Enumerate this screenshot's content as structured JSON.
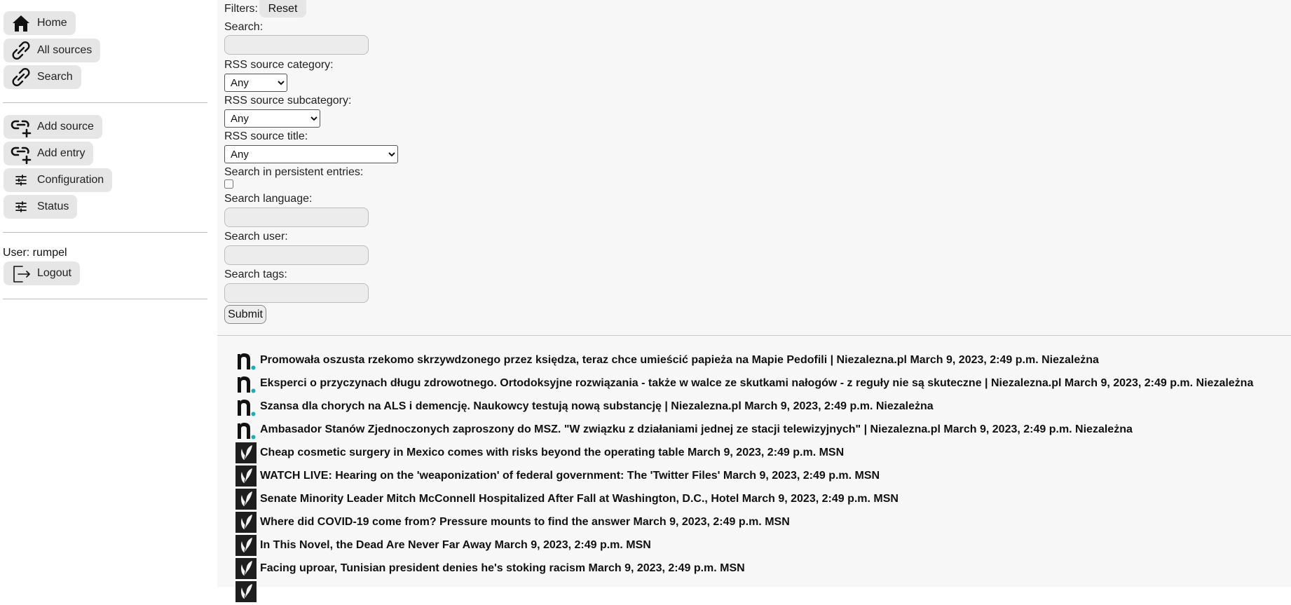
{
  "sidebar": {
    "nav": [
      {
        "label": "Home",
        "icon": "home-icon"
      },
      {
        "label": "All sources",
        "icon": "link-icon"
      },
      {
        "label": "Search",
        "icon": "link-icon"
      }
    ],
    "actions": [
      {
        "label": "Add source",
        "icon": "add-link-icon"
      },
      {
        "label": "Add entry",
        "icon": "add-link-icon"
      },
      {
        "label": "Configuration",
        "icon": "tune-icon"
      },
      {
        "label": "Status",
        "icon": "tune-icon"
      }
    ],
    "user_label": "User: rumpel",
    "logout_label": "Logout"
  },
  "filters": {
    "title": "Filters:",
    "reset_label": "Reset",
    "search_label": "Search:",
    "search_value": "",
    "category_label": "RSS source category:",
    "category_value": "Any",
    "subcategory_label": "RSS source subcategory:",
    "subcategory_value": "Any",
    "source_title_label": "RSS source title:",
    "source_title_value": "Any",
    "persistent_label": "Search in persistent entries:",
    "persistent_checked": false,
    "language_label": "Search language:",
    "language_value": "",
    "user_label": "Search user:",
    "user_value": "",
    "tags_label": "Search tags:",
    "tags_value": "",
    "submit_label": "Submit"
  },
  "entries": [
    {
      "text": "Promowała oszusta rzekomo skrzywdzonego przez księdza, teraz chce umieścić papieża na Mapie Pedofili | Niezalezna.pl March 9, 2023, 2:49 p.m. Niezależna",
      "source": "niezalezna-logo-icon"
    },
    {
      "text": "Eksperci o przyczynach długu zdrowotnego. Ortodoksyjne rozwiązania - także w walce ze skutkami nałogów - z reguły nie są skuteczne | Niezalezna.pl March 9, 2023, 2:49 p.m. Niezależna",
      "source": "niezalezna-logo-icon"
    },
    {
      "text": "Szansa dla chorych na ALS i demencję. Naukowcy testują nową substancję | Niezalezna.pl March 9, 2023, 2:49 p.m. Niezależna",
      "source": "niezalezna-logo-icon"
    },
    {
      "text": "Ambasador Stanów Zjednoczonych zaproszony do MSZ. \"W związku z działaniami jednej ze stacji telewizyjnych\" | Niezalezna.pl March 9, 2023, 2:49 p.m. Niezależna",
      "source": "niezalezna-logo-icon"
    },
    {
      "text": "Cheap cosmetic surgery in Mexico comes with risks beyond the operating table March 9, 2023, 2:49 p.m. MSN",
      "source": "msn-butterfly-icon"
    },
    {
      "text": "WATCH LIVE: Hearing on the 'weaponization' of federal government: The 'Twitter Files' March 9, 2023, 2:49 p.m. MSN",
      "source": "msn-butterfly-icon"
    },
    {
      "text": "Senate Minority Leader Mitch McConnell Hospitalized After Fall at Washington, D.C., Hotel March 9, 2023, 2:49 p.m. MSN",
      "source": "msn-butterfly-icon"
    },
    {
      "text": "Where did COVID-19 come from? Pressure mounts to find the answer March 9, 2023, 2:49 p.m. MSN",
      "source": "msn-butterfly-icon"
    },
    {
      "text": "In This Novel, the Dead Are Never Far Away March 9, 2023, 2:49 p.m. MSN",
      "source": "msn-butterfly-icon"
    },
    {
      "text": "Facing uproar, Tunisian president denies he's stoking racism March 9, 2023, 2:49 p.m. MSN",
      "source": "msn-butterfly-icon"
    },
    {
      "text": "",
      "source": "msn-butterfly-icon"
    }
  ],
  "colors": {
    "button_bg": "#e6e6e6",
    "main_bg": "#f7f7f7",
    "niezalezna_dot": "#10b3b9"
  }
}
